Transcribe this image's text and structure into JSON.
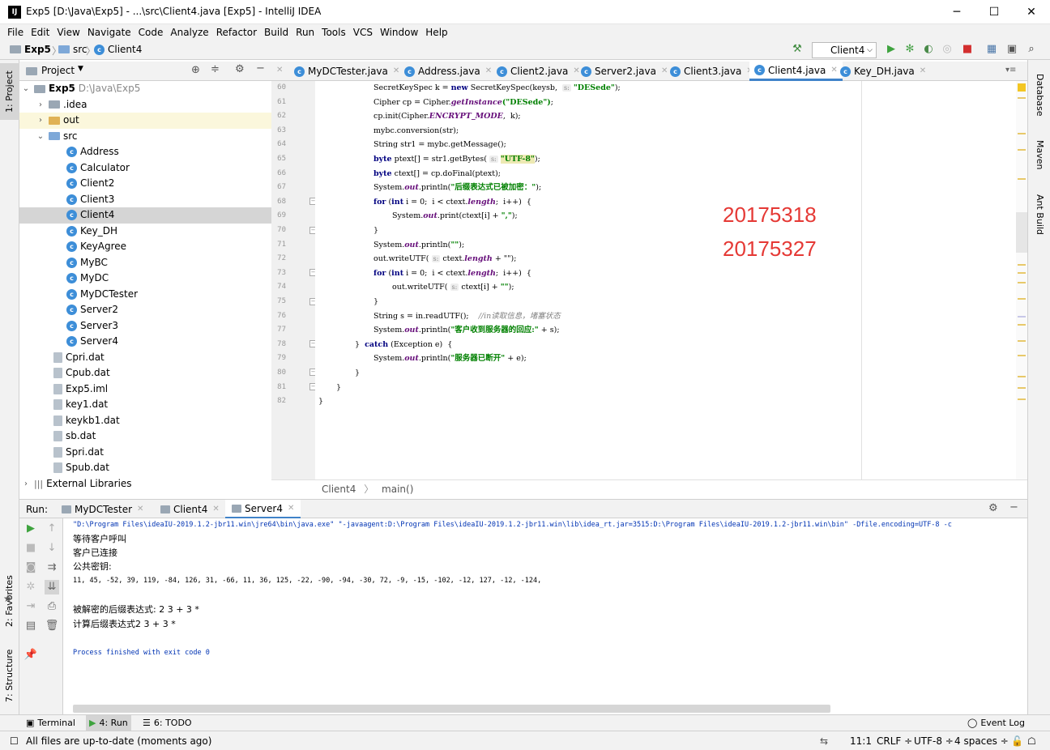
{
  "titlebar": {
    "title": "Exp5 [D:\\Java\\Exp5] - ...\\src\\Client4.java [Exp5] - IntelliJ IDEA",
    "logo": "IJ"
  },
  "window_controls": {
    "minimize": "─",
    "maximize": "☐",
    "close": "✕"
  },
  "menu": [
    "File",
    "Edit",
    "View",
    "Navigate",
    "Code",
    "Analyze",
    "Refactor",
    "Build",
    "Run",
    "Tools",
    "VCS",
    "Window",
    "Help"
  ],
  "navbar": {
    "project": "Exp5",
    "folder": "src",
    "file": "Client4",
    "run_config": "Client4"
  },
  "project_panel": {
    "title": "Project"
  },
  "tree": [
    {
      "label": "Exp5",
      "detail": "D:\\Java\\Exp5"
    },
    {
      "label": ".idea"
    },
    {
      "label": "out"
    },
    {
      "label": "src"
    },
    {
      "label": "Address"
    },
    {
      "label": "Calculator"
    },
    {
      "label": "Client2"
    },
    {
      "label": "Client3"
    },
    {
      "label": "Client4"
    },
    {
      "label": "Key_DH"
    },
    {
      "label": "KeyAgree"
    },
    {
      "label": "MyBC"
    },
    {
      "label": "MyDC"
    },
    {
      "label": "MyDCTester"
    },
    {
      "label": "Server2"
    },
    {
      "label": "Server3"
    },
    {
      "label": "Server4"
    },
    {
      "label": "Cpri.dat"
    },
    {
      "label": "Cpub.dat"
    },
    {
      "label": "Exp5.iml"
    },
    {
      "label": "key1.dat"
    },
    {
      "label": "keykb1.dat"
    },
    {
      "label": "sb.dat"
    },
    {
      "label": "Spri.dat"
    },
    {
      "label": "Spub.dat"
    },
    {
      "label": "External Libraries"
    }
  ],
  "editor_tabs": [
    "MyDCTester.java",
    "Address.java",
    "Client2.java",
    "Server2.java",
    "Client3.java",
    "Client4.java",
    "Key_DH.java"
  ],
  "line_numbers": [
    "60",
    "61",
    "62",
    "63",
    "64",
    "65",
    "66",
    "67",
    "68",
    "69",
    "70",
    "71",
    "72",
    "73",
    "74",
    "75",
    "76",
    "77",
    "78",
    "79",
    "80",
    "81",
    "82"
  ],
  "code": {
    "l60": {
      "a": "SecretKeySpec k = ",
      "kw": "new",
      "b": " SecretKeySpec(keysb,  ",
      "hint": "s:",
      "st": "\"DESede\"",
      "c": ");"
    },
    "l61": {
      "a": "Cipher cp = Cipher.",
      "it": "getInstance",
      "st": "(\"DESede\")",
      "c": ";"
    },
    "l62": {
      "a": "cp.init(Cipher.",
      "it": "ENCRYPT_MODE",
      "c": ",  k);"
    },
    "l63": {
      "a": "mybc.conversion(str);"
    },
    "l64": {
      "a": "String str1 = mybc.getMessage();"
    },
    "l65": {
      "kw": "byte",
      "a": " ptext[] = str1.getBytes( ",
      "hint": "s:",
      "st": "\"UTF-8\"",
      "c": ");"
    },
    "l66": {
      "kw": "byte",
      "a": " ctext[] = cp.doFinal(ptext);"
    },
    "l67": {
      "a": "System.",
      "it": "out",
      "b": ".println(",
      "st": "\"后缀表达式已被加密：\"",
      "c": ");"
    },
    "l68": {
      "kw": "for",
      "a": " (",
      "kw2": "int",
      "b": " i = 0;  i < ctext.",
      "st": "length",
      "c": ";  i++)  {"
    },
    "l69": {
      "a": "System.",
      "it": "out",
      "b": ".print(ctext[i] + ",
      "st": "\",\"",
      "c": ");"
    },
    "l70": {
      "a": "}"
    },
    "l71": {
      "a": "System.",
      "it": "out",
      "b": ".println(",
      "st": "\"\"",
      "c": ");"
    },
    "l72": {
      "a": "out.writeUTF( ",
      "hint": "s:",
      "b": " ctext.",
      "st": "length",
      "c": " + \"\");"
    },
    "l73": {
      "kw": "for",
      "a": " (",
      "kw2": "int",
      "b": " i = 0;  i < ctext.",
      "st": "length",
      "c": ";  i++)  {"
    },
    "l74": {
      "a": "out.writeUTF( ",
      "hint": "s:",
      "b": " ctext[i] + ",
      "st": "\"\"",
      "c": ");"
    },
    "l75": {
      "a": "}"
    },
    "l76": {
      "a": "String s = in.readUTF();    ",
      "cm": "//in读取信息，堵塞状态"
    },
    "l77": {
      "a": "System.",
      "it": "out",
      "b": ".println(",
      "st": "\"客户收到服务器的回应:\"",
      "c": " + s);"
    },
    "l78": {
      "a": "}  ",
      "kw": "catch",
      "b": " (Exception e)  {"
    },
    "l79": {
      "a": "System.",
      "it": "out",
      "b": ".println(",
      "st": "\"服务器已断开\"",
      "c": " + e);"
    },
    "l80": {
      "a": "}"
    },
    "l81": {
      "a": "}"
    },
    "l82": {
      "a": "}"
    }
  },
  "overlay": {
    "id1": "20175318",
    "id2": "20175327"
  },
  "editor_breadcrumb": {
    "cls": "Client4",
    "sep": "〉",
    "method": "main()"
  },
  "run_panel": {
    "label": "Run:",
    "tabs": [
      "MyDCTester",
      "Client4",
      "Server4"
    ]
  },
  "console": [
    "\"D:\\Program Files\\ideaIU-2019.1.2-jbr11.win\\jre64\\bin\\java.exe\" \"-javaagent:D:\\Program Files\\ideaIU-2019.1.2-jbr11.win\\lib\\idea_rt.jar=3515:D:\\Program Files\\ideaIU-2019.1.2-jbr11.win\\bin\" -Dfile.encoding=UTF-8 -c",
    "等待客户呼叫",
    "客户已连接",
    "公共密钥:",
    "11, 45, -52, 39, 119, -84, 126, 31, -66, 11, 36, 125, -22, -90, -94, -30, 72, -9, -15, -102, -12, 127, -12, -124,",
    "被解密的后缀表达式: 2 3 + 3 *",
    "计算后缀表达式2 3 + 3 *",
    "Process finished with exit code 0"
  ],
  "left_strip": {
    "project": "1: Project",
    "favorites": "2: Favorites",
    "structure": "7: Structure"
  },
  "right_strip": {
    "database": "Database",
    "maven": "Maven",
    "ant": "Ant Build"
  },
  "bottom_tabs": {
    "terminal": "Terminal",
    "run": "4: Run",
    "todo": "6: TODO",
    "event_log": "Event Log"
  },
  "status": {
    "message": "All files are up-to-date (moments ago)",
    "position": "11:1",
    "line_sep": "CRLF ÷",
    "encoding": "UTF-8 ÷",
    "indent": "4 spaces ÷"
  }
}
